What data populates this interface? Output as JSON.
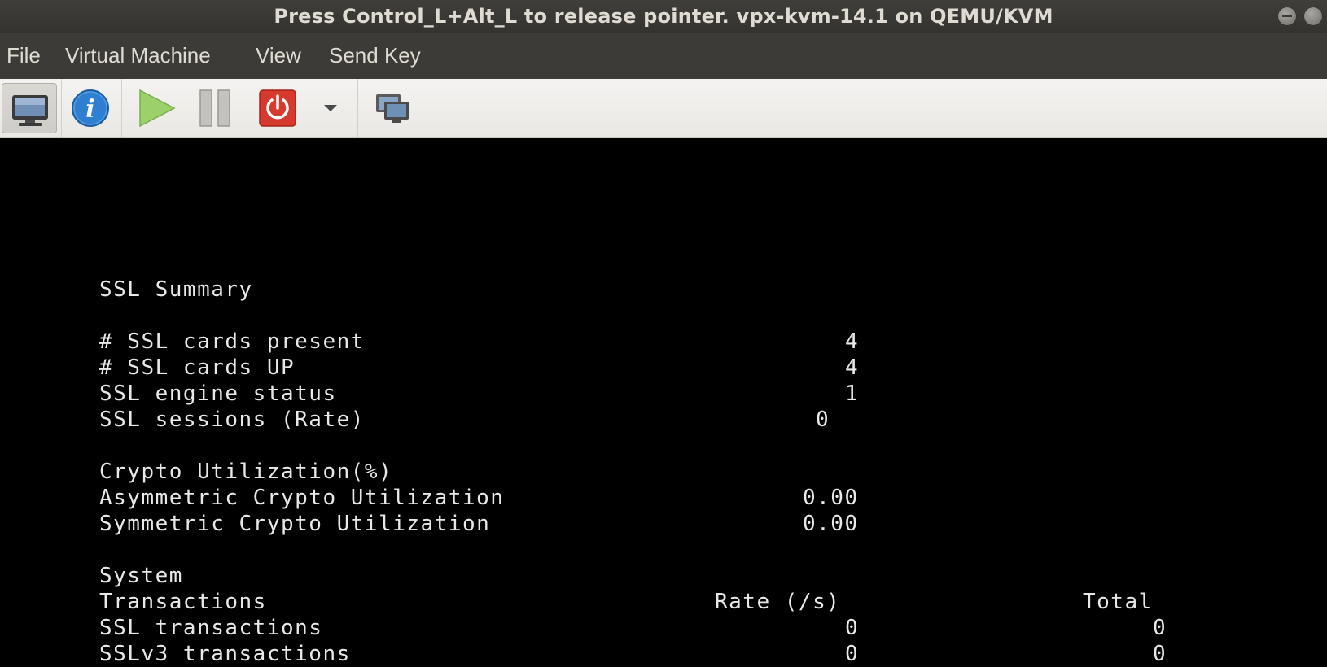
{
  "window": {
    "title": "Press Control_L+Alt_L to release pointer. vpx-kvm-14.1 on QEMU/KVM"
  },
  "menu": {
    "items": [
      "File",
      "Virtual Machine",
      "View",
      "Send Key"
    ]
  },
  "toolbar": {
    "buttons": [
      {
        "icon": "monitor-icon",
        "tooltip": "Show the graphical console"
      },
      {
        "icon": "info-icon",
        "tooltip": "Show virtual hardware details"
      },
      {
        "icon": "play-icon",
        "tooltip": "Run"
      },
      {
        "icon": "pause-icon",
        "tooltip": "Pause"
      },
      {
        "icon": "power-icon",
        "tooltip": "Shut down"
      },
      {
        "icon": "dropdown-arrow-icon",
        "tooltip": ""
      },
      {
        "icon": "snapshot-icon",
        "tooltip": "Manage snapshots"
      }
    ],
    "colors": {
      "info": "#2f7fd0",
      "play": "#9bd06a",
      "power": "#d63a2e"
    }
  },
  "console": {
    "title": "SSL Summary",
    "cards_present_label": "# SSL cards present",
    "cards_present_value": "4",
    "cards_up_label": "# SSL cards UP",
    "cards_up_value": "4",
    "engine_status_label": "SSL engine status",
    "engine_status_value": "1",
    "sessions_label": "SSL sessions (Rate)",
    "sessions_value": "0",
    "crypto_title": "Crypto Utilization(%)",
    "asym_label": "Asymmetric Crypto Utilization",
    "asym_value": "0.00",
    "sym_label": "Symmetric Crypto Utilization",
    "sym_value": "0.00",
    "system_title": "System",
    "transactions_label": "Transactions",
    "rate_header": "Rate (/s)",
    "total_header": "Total",
    "ssl_tx_label": "SSL transactions",
    "ssl_tx_rate": "0",
    "ssl_tx_total": "0",
    "sslv3_tx_label": "SSLv3 transactions",
    "sslv3_tx_rate": "0",
    "sslv3_tx_total": "0"
  }
}
